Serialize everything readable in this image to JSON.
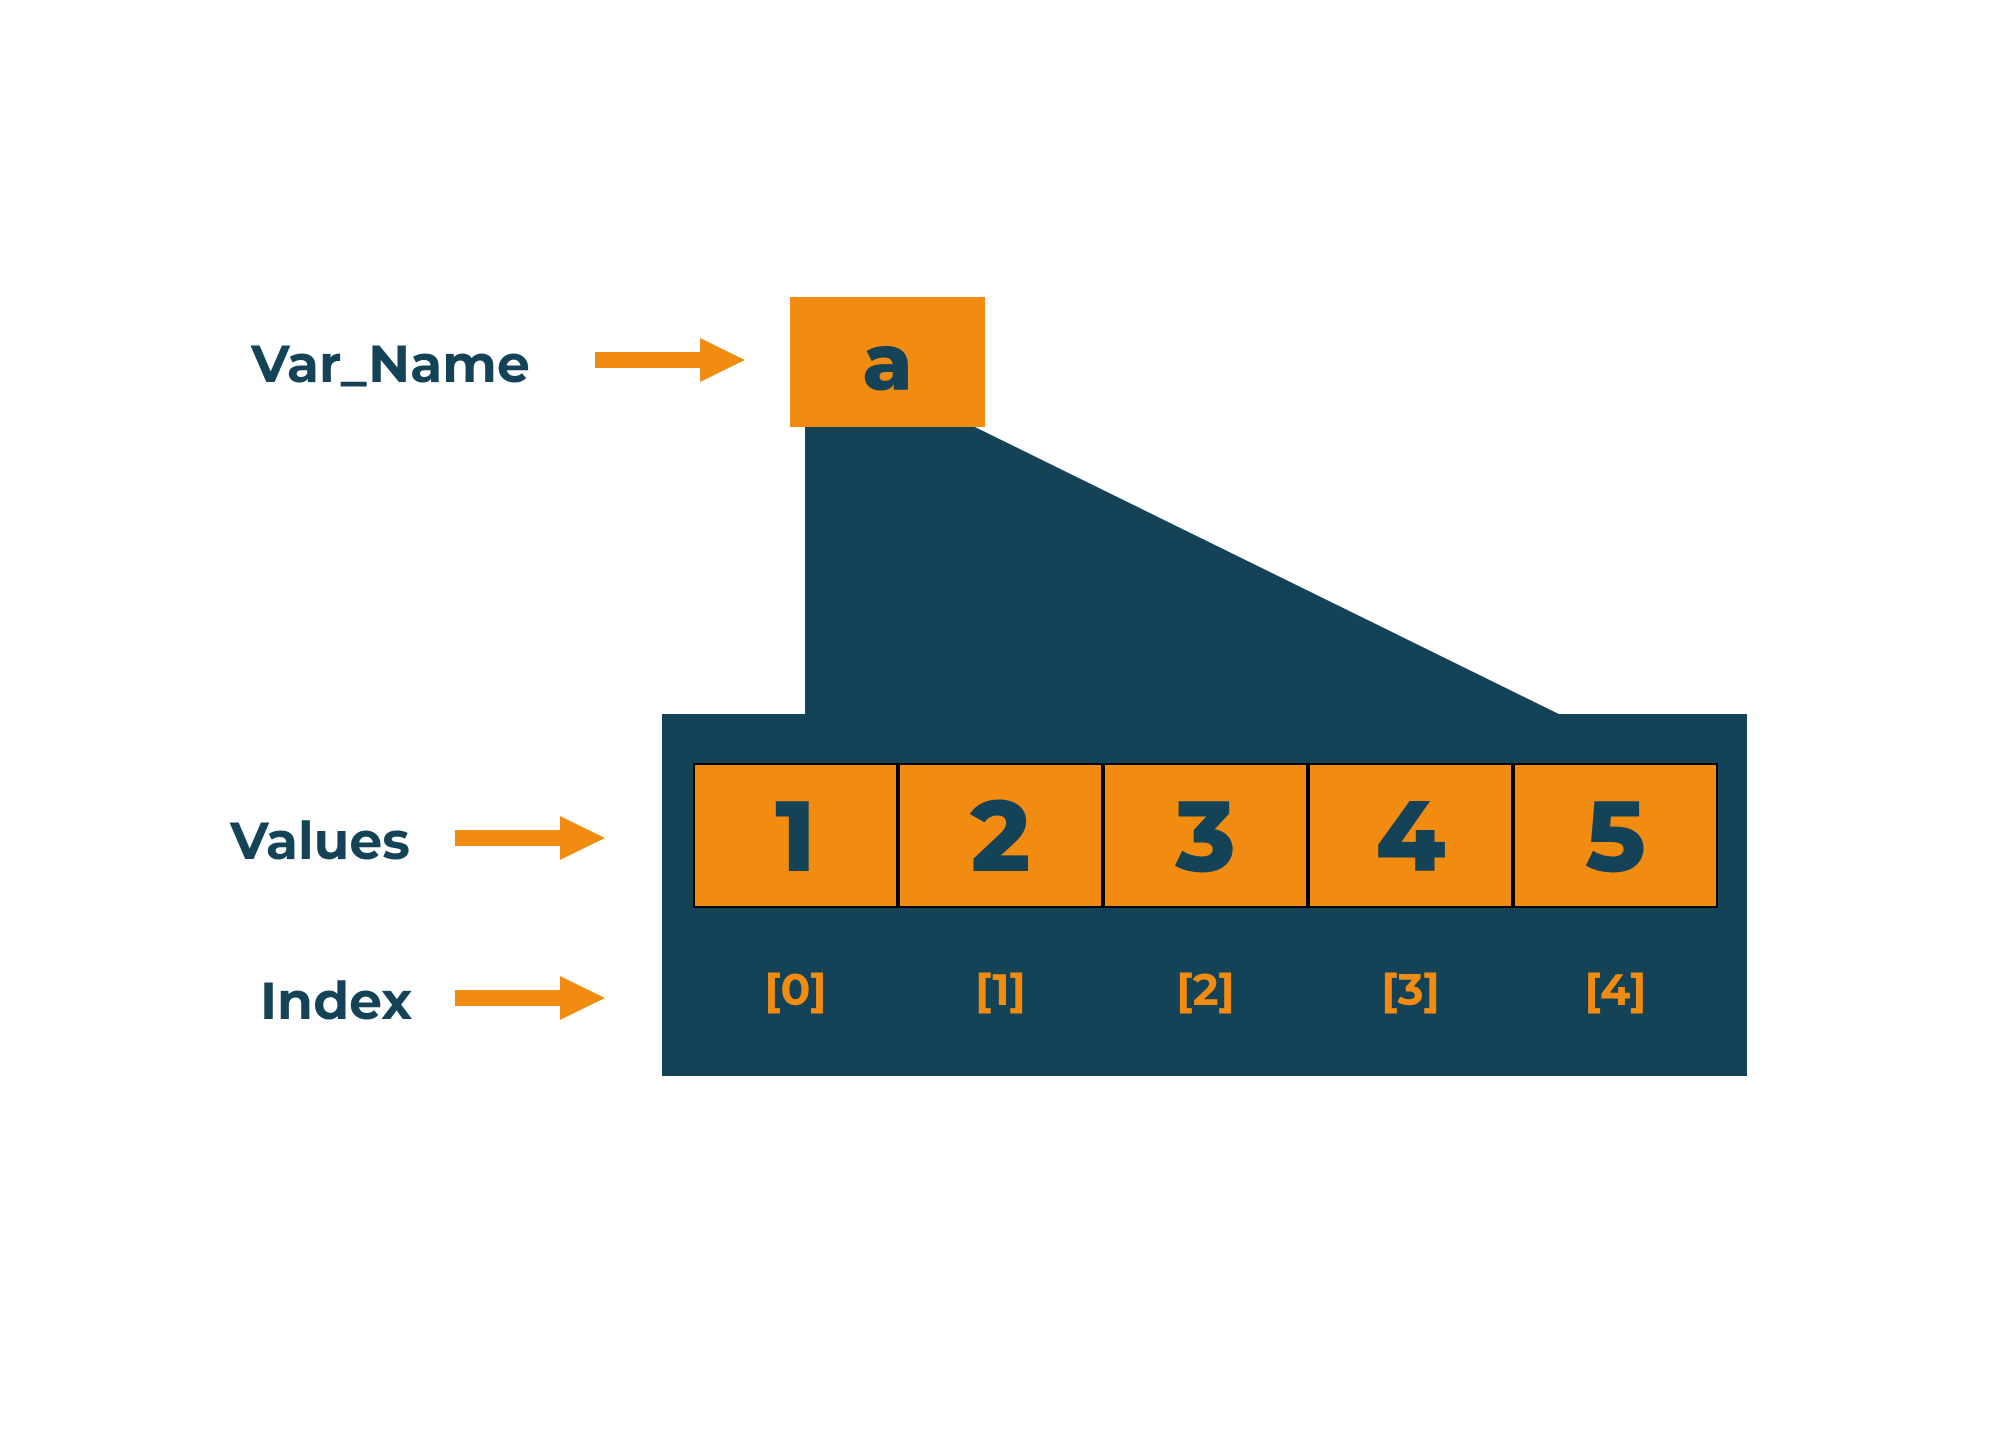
{
  "labels": {
    "var_name": "Var_Name",
    "values": "Values",
    "index": "Index"
  },
  "variable_name": "a",
  "array_values": [
    "1",
    "2",
    "3",
    "4",
    "5"
  ],
  "array_indices": [
    "[0]",
    "[1]",
    "[2]",
    "[3]",
    "[4]"
  ],
  "colors": {
    "dark": "#144257",
    "orange": "#F28C10"
  }
}
